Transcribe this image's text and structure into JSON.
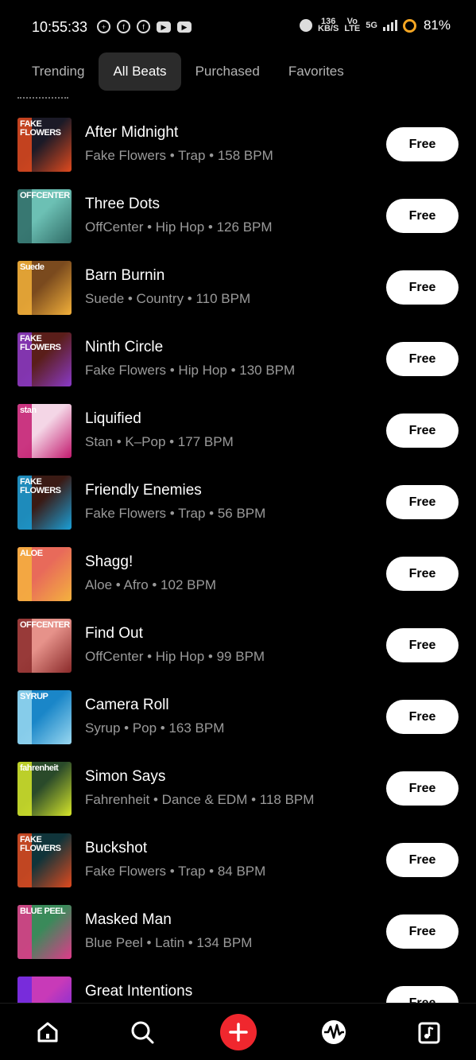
{
  "status_bar": {
    "time": "10:55:33",
    "net_speed_top": "136",
    "net_speed_bottom": "KB/S",
    "volte_top": "Vo",
    "volte_bottom": "LTE",
    "network": "5G",
    "battery": "81%"
  },
  "tabs": [
    {
      "label": "Trending",
      "active": false
    },
    {
      "label": "All Beats",
      "active": true
    },
    {
      "label": "Purchased",
      "active": false
    },
    {
      "label": "Favorites",
      "active": false
    }
  ],
  "beats": [
    {
      "title": "After Midnight",
      "meta": "Fake Flowers • Trap • 158 BPM",
      "button": "Free",
      "art_label": "FAKE FLOWERS",
      "art_bg": "#1b1a27",
      "art_accent": "#e14a1e"
    },
    {
      "title": "Three Dots",
      "meta": "OffCenter • Hip Hop • 126 BPM",
      "button": "Free",
      "art_label": "OFFCENTER",
      "art_bg": "#6cc0b4",
      "art_accent": "#2f6b66"
    },
    {
      "title": "Barn Burnin",
      "meta": "Suede • Country • 110 BPM",
      "button": "Free",
      "art_label": "Suede",
      "art_bg": "#7a4a1e",
      "art_accent": "#f2b03a"
    },
    {
      "title": "Ninth Circle",
      "meta": "Fake Flowers • Hip Hop • 130 BPM",
      "button": "Free",
      "art_label": "FAKE FLOWERS",
      "art_bg": "#5a1e1a",
      "art_accent": "#8a3ac9"
    },
    {
      "title": "Liquified",
      "meta": "Stan • K–Pop • 177 BPM",
      "button": "Free",
      "art_label": "stan",
      "art_bg": "#f4d6e6",
      "art_accent": "#c21a6e"
    },
    {
      "title": "Friendly Enemies",
      "meta": "Fake Flowers • Trap • 56 BPM",
      "button": "Free",
      "art_label": "FAKE FLOWERS",
      "art_bg": "#3a1a14",
      "art_accent": "#1aa0d8"
    },
    {
      "title": "Shagg!",
      "meta": "Aloe • Afro • 102 BPM",
      "button": "Free",
      "art_label": "ALOE",
      "art_bg": "#e86a5a",
      "art_accent": "#f4b23e"
    },
    {
      "title": "Find Out",
      "meta": "OffCenter • Hip Hop • 99 BPM",
      "button": "Free",
      "art_label": "OFFCENTER",
      "art_bg": "#e6928a",
      "art_accent": "#8a2a2a"
    },
    {
      "title": "Camera Roll",
      "meta": "Syrup • Pop • 163 BPM",
      "button": "Free",
      "art_label": "SYRUP",
      "art_bg": "#1a86c8",
      "art_accent": "#9ad8f0"
    },
    {
      "title": "Simon Says",
      "meta": "Fahrenheit • Dance & EDM • 118 BPM",
      "button": "Free",
      "art_label": "fahrenheit",
      "art_bg": "#2a4a2a",
      "art_accent": "#d6e62a"
    },
    {
      "title": "Buckshot",
      "meta": "Fake Flowers • Trap • 84 BPM",
      "button": "Free",
      "art_label": "FAKE FLOWERS",
      "art_bg": "#10343a",
      "art_accent": "#e14a1e"
    },
    {
      "title": "Masked Man",
      "meta": "Blue Peel • Latin • 134 BPM",
      "button": "Free",
      "art_label": "BLUE PEEL",
      "art_bg": "#3a8a5a",
      "art_accent": "#e03a8a"
    },
    {
      "title": "Great Intentions",
      "meta": "",
      "button": "Free",
      "art_label": "",
      "art_bg": "#c83ab8",
      "art_accent": "#6a2ae0"
    }
  ],
  "nav": [
    {
      "name": "home-icon"
    },
    {
      "name": "search-icon"
    },
    {
      "name": "add-icon"
    },
    {
      "name": "waveform-icon"
    },
    {
      "name": "music-library-icon"
    }
  ]
}
